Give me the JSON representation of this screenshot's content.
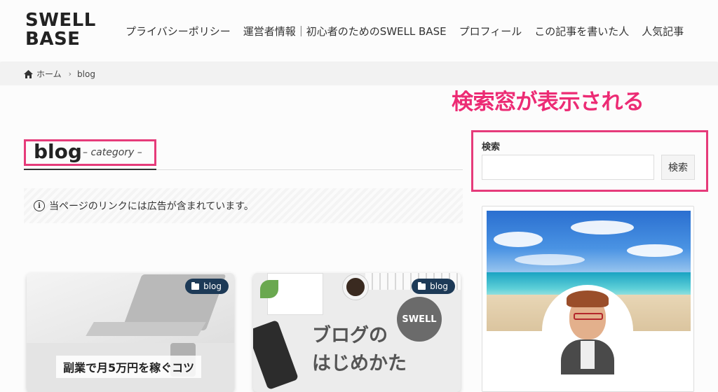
{
  "site": {
    "logo_line1": "SWELL",
    "logo_line2": "BASE"
  },
  "nav": {
    "items": [
      "プライバシーポリシー",
      "運営者情報｜初心者のためのSWELL BASE",
      "プロフィール",
      "この記事を書いた人",
      "人気記事"
    ]
  },
  "breadcrumb": {
    "home": "ホーム",
    "current": "blog"
  },
  "annotation": {
    "text": "検索窓が表示される",
    "color": "#ec2b74"
  },
  "page": {
    "title": "blog",
    "subtitle": "– category –"
  },
  "notice": {
    "text": "当ページのリンクには広告が含まれています。"
  },
  "cards": [
    {
      "category": "blog",
      "label": "副業で月5万円を稼ぐコツ"
    },
    {
      "category": "blog",
      "text_line1": "ブログの",
      "text_line2": "はじめかた",
      "logo": "SWELL"
    }
  ],
  "sidebar": {
    "search_title": "検索",
    "search_placeholder": "",
    "search_button": "検索"
  },
  "colors": {
    "highlight_border": "#e63b7a",
    "badge_bg": "#1d3a57"
  }
}
